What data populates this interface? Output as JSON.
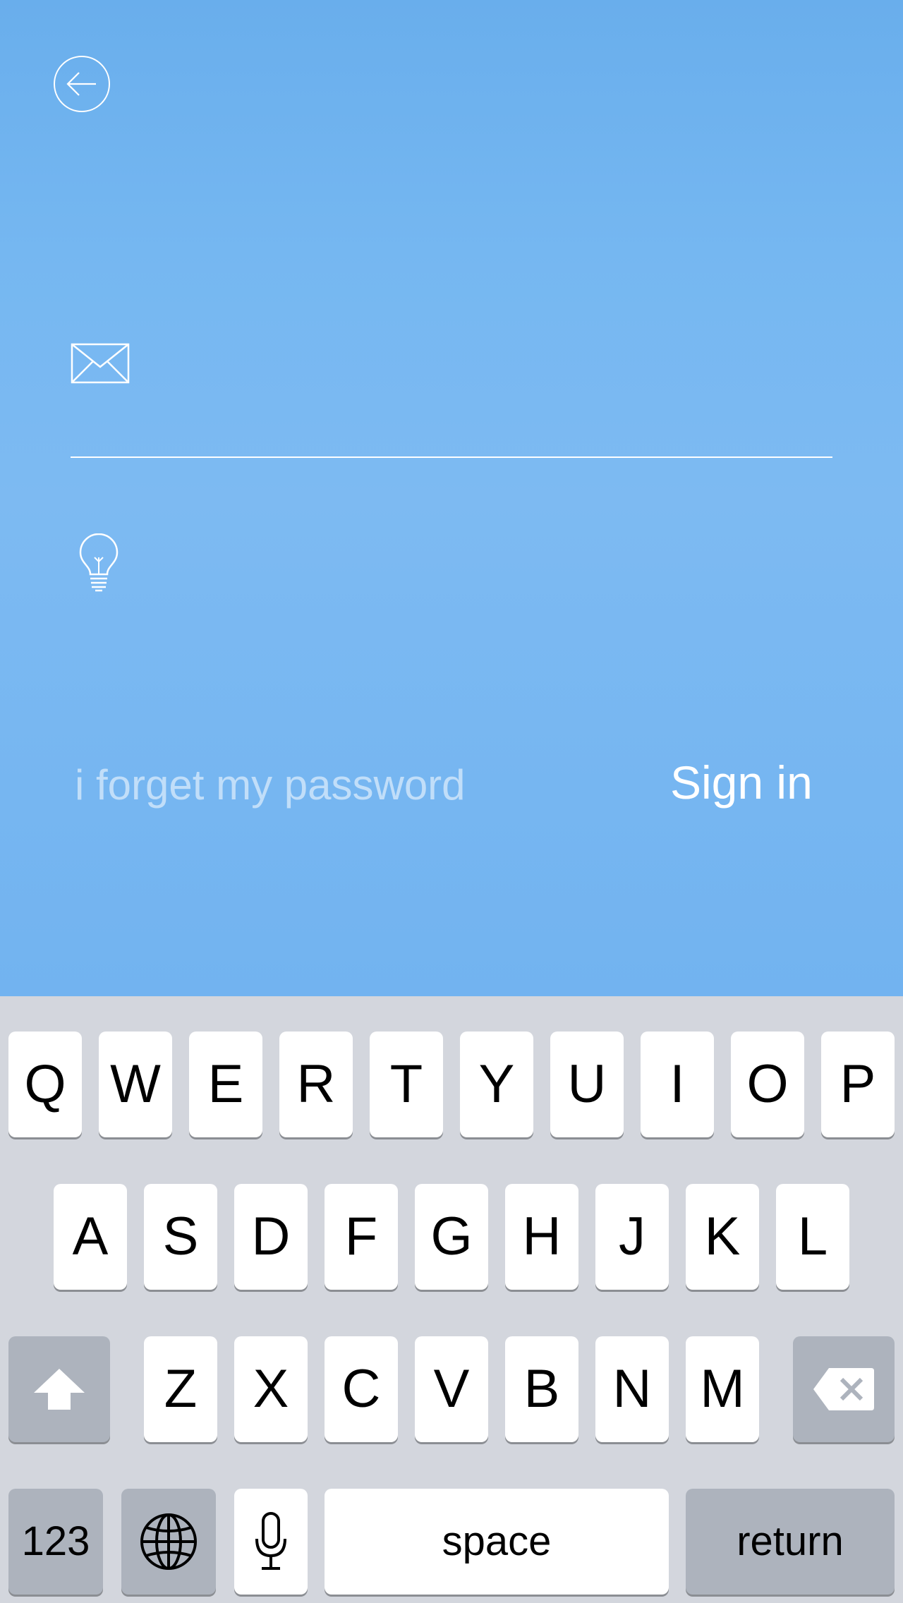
{
  "login": {
    "back_icon": "arrow-left-circle-icon",
    "email_icon": "envelope-icon",
    "password_icon": "lightbulb-icon",
    "email_value": "",
    "password_value": "",
    "forgot_label": "i forget my password",
    "signin_label": "Sign in"
  },
  "keyboard": {
    "row1": [
      "Q",
      "W",
      "E",
      "R",
      "T",
      "Y",
      "U",
      "I",
      "O",
      "P"
    ],
    "row2": [
      "A",
      "S",
      "D",
      "F",
      "G",
      "H",
      "J",
      "K",
      "L"
    ],
    "row3": [
      "Z",
      "X",
      "C",
      "V",
      "B",
      "N",
      "M"
    ],
    "numbers_label": "123",
    "space_label": "space",
    "return_label": "return",
    "shift_icon": "shift-arrow-icon",
    "backspace_icon": "backspace-icon",
    "globe_icon": "globe-icon",
    "mic_icon": "microphone-icon"
  },
  "colors": {
    "background_blue": "#75b7f1",
    "keyboard_bg": "#d3d6dd",
    "key_white": "#ffffff",
    "key_dark": "#adb3bd"
  }
}
